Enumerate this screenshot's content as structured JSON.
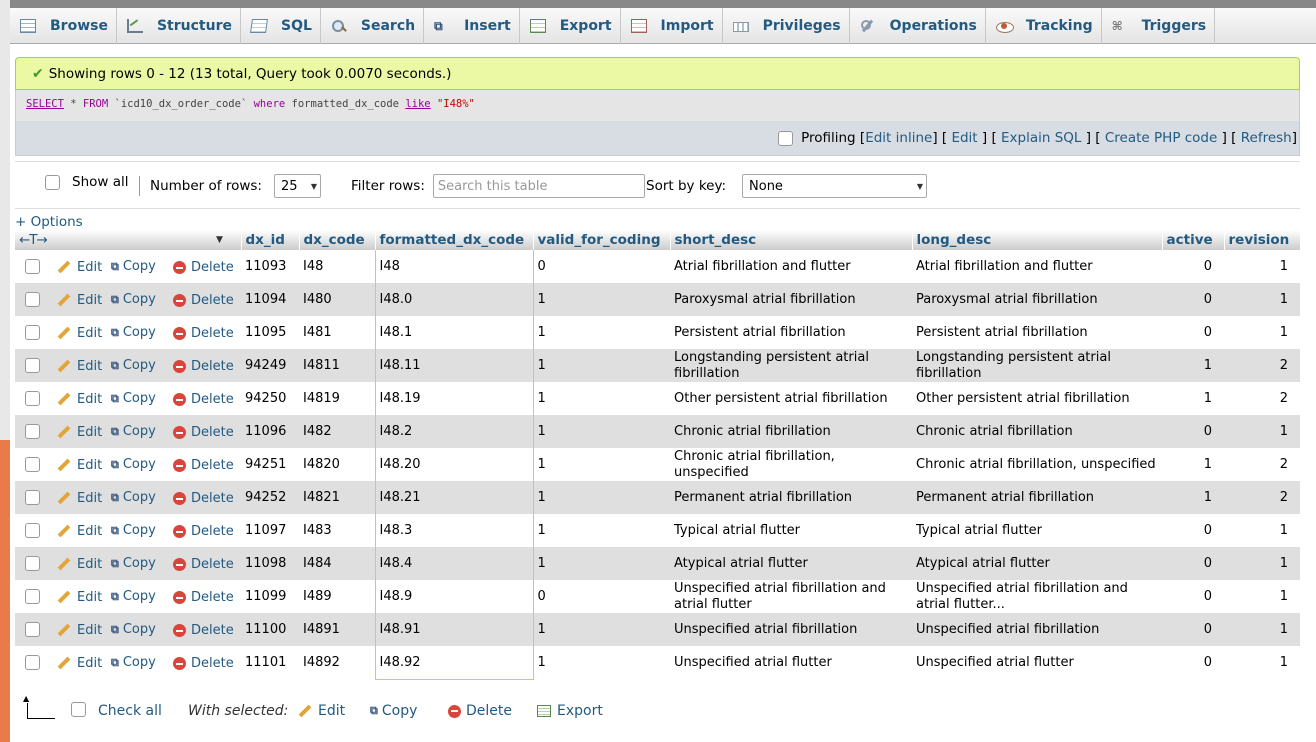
{
  "tabs": [
    {
      "label": "Browse",
      "icon": "browse-icon"
    },
    {
      "label": "Structure",
      "icon": "structure-icon"
    },
    {
      "label": "SQL",
      "icon": "sql-icon"
    },
    {
      "label": "Search",
      "icon": "search-icon"
    },
    {
      "label": "Insert",
      "icon": "insert-icon"
    },
    {
      "label": "Export",
      "icon": "export-icon"
    },
    {
      "label": "Import",
      "icon": "import-icon"
    },
    {
      "label": "Privileges",
      "icon": "privileges-icon"
    },
    {
      "label": "Operations",
      "icon": "operations-icon"
    },
    {
      "label": "Tracking",
      "icon": "tracking-icon"
    },
    {
      "label": "Triggers",
      "icon": "triggers-icon"
    }
  ],
  "message": {
    "text": "Showing rows 0 - 12 (13 total, Query took 0.0070 seconds.)"
  },
  "sql": {
    "select": "SELECT",
    "star": " * ",
    "from": "FROM",
    "table": " `icd10_dx_order_code` ",
    "where": "where",
    "column": " formatted_dx_code ",
    "like": "like",
    "value": " \"I48%\""
  },
  "profiling": {
    "label": "Profiling",
    "links": {
      "edit_inline": "Edit inline",
      "edit": "Edit",
      "explain": "Explain SQL",
      "php": "Create PHP code",
      "refresh": "Refresh"
    }
  },
  "nav": {
    "show_all": "Show all",
    "rows_label": "Number of rows:",
    "rows_value": "25",
    "filter_label": "Filter rows:",
    "filter_placeholder": "Search this table",
    "sort_label": "Sort by key:",
    "sort_value": "None"
  },
  "options_label": "+ Options",
  "columns": [
    "dx_id",
    "dx_code",
    "formatted_dx_code",
    "valid_for_coding",
    "short_desc",
    "long_desc",
    "active",
    "revision"
  ],
  "row_actions": {
    "edit": "Edit",
    "copy": "Copy",
    "delete": "Delete"
  },
  "rows": [
    {
      "dx_id": "11093",
      "dx_code": "I48",
      "formatted": "I48",
      "valid": "0",
      "short": "Atrial fibrillation and flutter",
      "long": "Atrial fibrillation and flutter",
      "active": "0",
      "revision": "1"
    },
    {
      "dx_id": "11094",
      "dx_code": "I480",
      "formatted": "I48.0",
      "valid": "1",
      "short": "Paroxysmal atrial fibrillation",
      "long": "Paroxysmal atrial fibrillation",
      "active": "0",
      "revision": "1"
    },
    {
      "dx_id": "11095",
      "dx_code": "I481",
      "formatted": "I48.1",
      "valid": "1",
      "short": "Persistent atrial fibrillation",
      "long": "Persistent atrial fibrillation",
      "active": "0",
      "revision": "1"
    },
    {
      "dx_id": "94249",
      "dx_code": "I4811",
      "formatted": "I48.11",
      "valid": "1",
      "short": "Longstanding persistent atrial fibrillation",
      "long": "Longstanding persistent atrial fibrillation",
      "active": "1",
      "revision": "2"
    },
    {
      "dx_id": "94250",
      "dx_code": "I4819",
      "formatted": "I48.19",
      "valid": "1",
      "short": "Other persistent atrial fibrillation",
      "long": "Other persistent atrial fibrillation",
      "active": "1",
      "revision": "2"
    },
    {
      "dx_id": "11096",
      "dx_code": "I482",
      "formatted": "I48.2",
      "valid": "1",
      "short": "Chronic atrial fibrillation",
      "long": "Chronic atrial fibrillation",
      "active": "0",
      "revision": "1"
    },
    {
      "dx_id": "94251",
      "dx_code": "I4820",
      "formatted": "I48.20",
      "valid": "1",
      "short": "Chronic atrial fibrillation, unspecified",
      "long": "Chronic atrial fibrillation, unspecified",
      "active": "1",
      "revision": "2"
    },
    {
      "dx_id": "94252",
      "dx_code": "I4821",
      "formatted": "I48.21",
      "valid": "1",
      "short": "Permanent atrial fibrillation",
      "long": "Permanent atrial fibrillation",
      "active": "1",
      "revision": "2"
    },
    {
      "dx_id": "11097",
      "dx_code": "I483",
      "formatted": "I48.3",
      "valid": "1",
      "short": "Typical atrial flutter",
      "long": "Typical atrial flutter",
      "active": "0",
      "revision": "1"
    },
    {
      "dx_id": "11098",
      "dx_code": "I484",
      "formatted": "I48.4",
      "valid": "1",
      "short": "Atypical atrial flutter",
      "long": "Atypical atrial flutter",
      "active": "0",
      "revision": "1"
    },
    {
      "dx_id": "11099",
      "dx_code": "I489",
      "formatted": "I48.9",
      "valid": "0",
      "short": "Unspecified atrial fibrillation and atrial flutter",
      "long": "Unspecified atrial fibrillation and atrial flutter...",
      "active": "0",
      "revision": "1"
    },
    {
      "dx_id": "11100",
      "dx_code": "I4891",
      "formatted": "I48.91",
      "valid": "1",
      "short": "Unspecified atrial fibrillation",
      "long": "Unspecified atrial fibrillation",
      "active": "0",
      "revision": "1"
    },
    {
      "dx_id": "11101",
      "dx_code": "I4892",
      "formatted": "I48.92",
      "valid": "1",
      "short": "Unspecified atrial flutter",
      "long": "Unspecified atrial flutter",
      "active": "0",
      "revision": "1"
    }
  ],
  "bottom": {
    "check_all": "Check all",
    "with_selected": "With selected:",
    "edit": "Edit",
    "copy": "Copy",
    "delete": "Delete",
    "export": "Export"
  }
}
